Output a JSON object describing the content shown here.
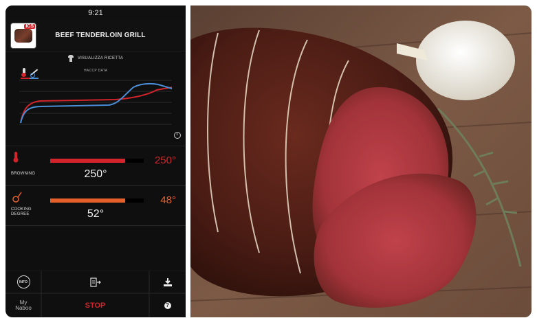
{
  "status_bar": {
    "time": "9:21"
  },
  "header": {
    "thumb_badge": "ICS",
    "title": "BEEF TENDERLOIN GRILL"
  },
  "recipe_link": {
    "label": "VISUALIZZA RICETTA"
  },
  "chart": {
    "label": "HACCP DATA"
  },
  "browning": {
    "label_lines": [
      "BROWNING"
    ],
    "value": "250°",
    "target": "250°",
    "progress": 0.8,
    "color": "#d2242a"
  },
  "cooking": {
    "label_lines": [
      "COOKING",
      "DEGREE"
    ],
    "value": "52°",
    "target": "48°",
    "progress": 0.8,
    "color": "#e6602a"
  },
  "footer": {
    "info_label": "INFO",
    "stop_label": "STOP",
    "logo_line1": "My",
    "logo_line2": "Naboo",
    "help_glyph": "?"
  }
}
